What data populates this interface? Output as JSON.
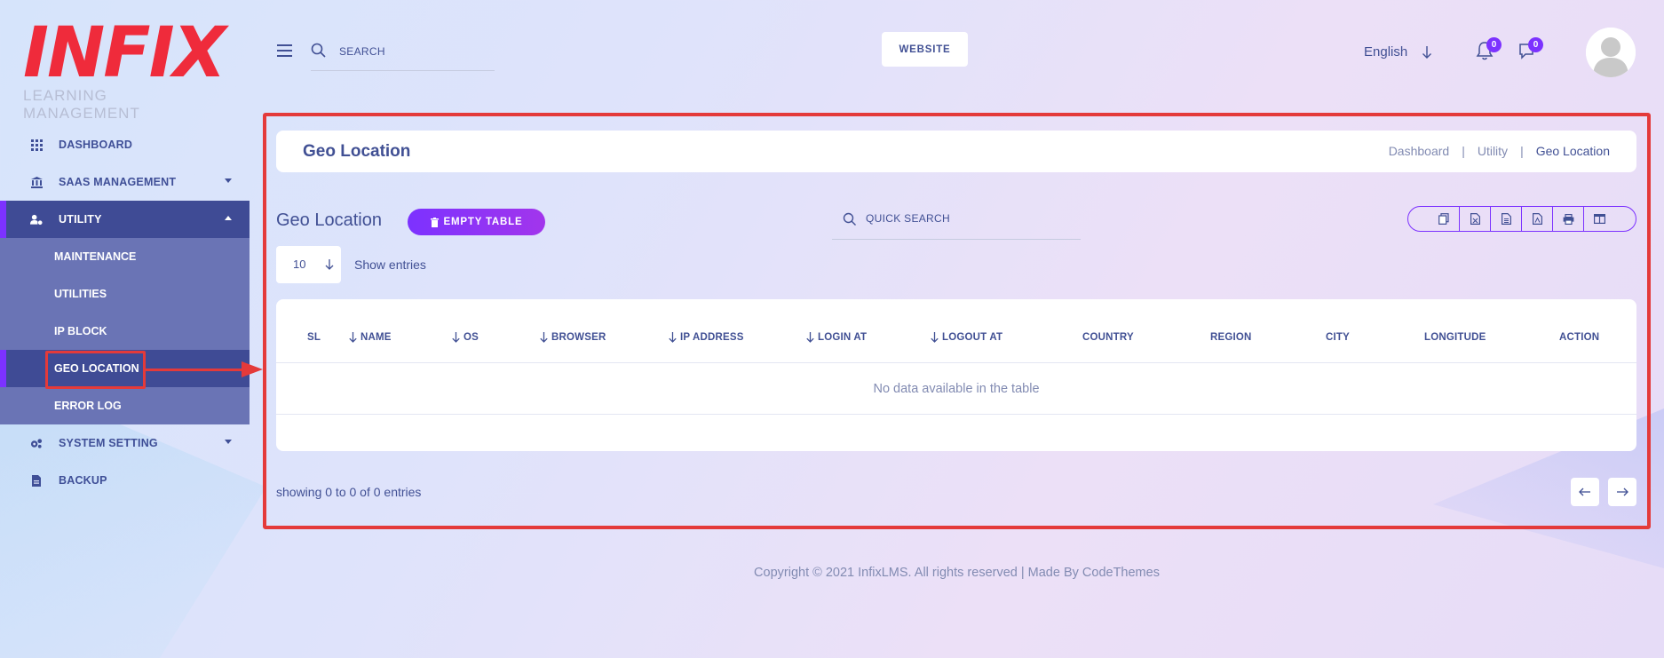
{
  "logo": {
    "mark": "INFIX",
    "subtitle": "LEARNING MANAGEMENT"
  },
  "sidebar": {
    "items": [
      {
        "label": "DASHBOARD",
        "icon": "grid-icon"
      },
      {
        "label": "SAAS MANAGEMENT",
        "icon": "bank-icon"
      },
      {
        "label": "UTILITY",
        "icon": "user-gear-icon"
      },
      {
        "label": "SYSTEM SETTING",
        "icon": "gears-icon"
      },
      {
        "label": "BACKUP",
        "icon": "file-icon"
      }
    ],
    "utility_sub": [
      "MAINTENANCE",
      "UTILITIES",
      "IP BLOCK",
      "GEO LOCATION",
      "ERROR LOG"
    ]
  },
  "header": {
    "search_placeholder": "SEARCH",
    "website_label": "WEBSITE",
    "language": "English",
    "notification_count": "0",
    "message_count": "0"
  },
  "page": {
    "title": "Geo Location",
    "breadcrumb": [
      "Dashboard",
      "Utility",
      "Geo Location"
    ],
    "section_title": "Geo Location",
    "empty_table_label": "EMPTY TABLE",
    "quick_search_placeholder": "QUICK SEARCH",
    "entries_value": "10",
    "show_entries_label": "Show entries",
    "table": {
      "columns": [
        "SL",
        "NAME",
        "OS",
        "BROWSER",
        "IP ADDRESS",
        "LOGIN AT",
        "LOGOUT AT",
        "COUNTRY",
        "REGION",
        "CITY",
        "LONGITUDE",
        "ACTION"
      ],
      "empty_text": "No data available in the table"
    },
    "showing_text": "showing 0 to 0 of 0 entries"
  },
  "footer": {
    "text": "Copyright © 2021 InfixLMS. All rights reserved | Made By CodeThemes"
  },
  "colors": {
    "accent": "#7c32ff",
    "primary": "#415094",
    "highlight": "#e43a3a"
  }
}
